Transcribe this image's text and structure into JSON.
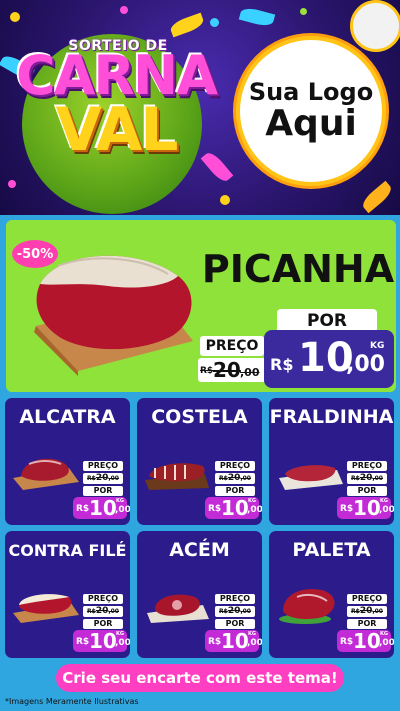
{
  "header": {
    "badge_top": "SORTEIO DE",
    "badge_line1": "CARNA",
    "badge_line2": "VAL",
    "logo_line1": "Sua Logo",
    "logo_line2": "Aqui"
  },
  "hero": {
    "discount": "-50%",
    "name": "PICANHA",
    "por_label": "POR",
    "preco_label": "PREÇO",
    "old_currency": "R$",
    "old_int": "20",
    "old_dec": ",00",
    "currency": "R$",
    "price_int": "10",
    "price_dec": ",00",
    "unit": "KG"
  },
  "cards": [
    {
      "name": "ALCATRA",
      "preco_label": "PREÇO",
      "old_currency": "R$",
      "old_price": "20",
      "old_dec": ",00",
      "por_label": "POR",
      "currency": "R$",
      "price_int": "10",
      "price_dec": ",00",
      "unit": "KG"
    },
    {
      "name": "COSTELA",
      "preco_label": "PREÇO",
      "old_currency": "R$",
      "old_price": "20",
      "old_dec": ",00",
      "por_label": "POR",
      "currency": "R$",
      "price_int": "10",
      "price_dec": ",00",
      "unit": "KG"
    },
    {
      "name": "FRALDINHA",
      "preco_label": "PREÇO",
      "old_currency": "R$",
      "old_price": "20",
      "old_dec": ",00",
      "por_label": "POR",
      "currency": "R$",
      "price_int": "10",
      "price_dec": ",00",
      "unit": "KG"
    },
    {
      "name": "CONTRA FILÉ",
      "preco_label": "PREÇO",
      "old_currency": "R$",
      "old_price": "20",
      "old_dec": ",00",
      "por_label": "POR",
      "currency": "R$",
      "price_int": "10",
      "price_dec": ",00",
      "unit": "KG"
    },
    {
      "name": "ACÉM",
      "preco_label": "PREÇO",
      "old_currency": "R$",
      "old_price": "20",
      "old_dec": ",00",
      "por_label": "POR",
      "currency": "R$",
      "price_int": "10",
      "price_dec": ",00",
      "unit": "KG"
    },
    {
      "name": "PALETA",
      "preco_label": "PREÇO",
      "old_currency": "R$",
      "old_price": "20",
      "old_dec": ",00",
      "por_label": "POR",
      "currency": "R$",
      "price_int": "10",
      "price_dec": ",00",
      "unit": "KG"
    }
  ],
  "footer": {
    "cta": "Crie seu encarte com este tema!",
    "disclaimer": "*Imagens Meramente Ilustrativas"
  },
  "colors": {
    "header_bg": "#2b166f",
    "content_bg": "#2fa6e0",
    "hero_bg": "#8ee23a",
    "card_bg": "#2c1b8a",
    "price_bg": "#c22bd6",
    "accent_pink": "#ff3fc1"
  }
}
